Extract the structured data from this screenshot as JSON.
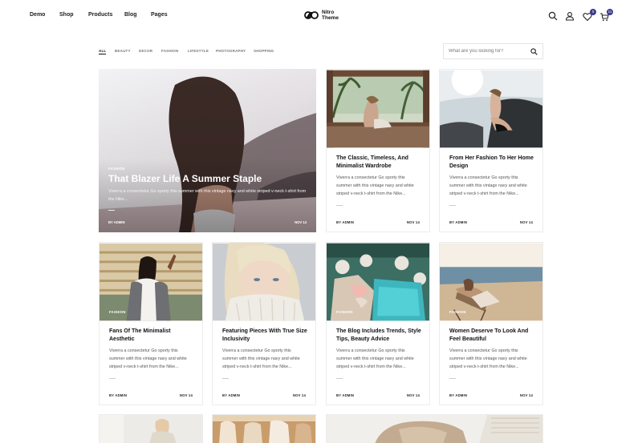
{
  "nav": {
    "items": [
      "Demo",
      "Shop",
      "Products",
      "Blog",
      "Pages"
    ]
  },
  "logo": {
    "line1": "Nitro",
    "line2": "Theme"
  },
  "header_icons": {
    "wishlist_count": "0",
    "cart_count": "11",
    "icons": [
      "search-icon",
      "account-icon",
      "heart-icon",
      "cart-icon"
    ]
  },
  "filters": {
    "items": [
      "ALL",
      "BEAUTY",
      "DECOR",
      "FASHION",
      "LIFESTYLE",
      "PHOTOGRAPHY",
      "SHOPPING"
    ],
    "active": "ALL"
  },
  "search": {
    "placeholder": "What are you looking for?"
  },
  "featured": {
    "category": "FASHION",
    "title": "That Blazer Life A Summer Staple",
    "excerpt": "Viverra a consectetur Go sporty this summer with this vintage navy and white striped v-neck t-shirt from the Nike...",
    "by": "BY ADMIN",
    "date": "NOV 14"
  },
  "posts": [
    {
      "title": "The Classic, Timeless, And Minimalist Wardrobe",
      "excerpt": "Viverra a consectetur Go sporty this summer with this vintage navy and white striped v-neck t-shirt from the Nike...",
      "by": "BY ADMIN",
      "date": "NOV 14",
      "category": ""
    },
    {
      "title": "From Her Fashion To Her Home Design",
      "excerpt": "Viverra a consectetur Go sporty this summer with this vintage navy and white striped v-neck t-shirt from the Nike...",
      "by": "BY ADMIN",
      "date": "NOV 14",
      "category": ""
    },
    {
      "title": "Fans Of The Minimalist Aesthetic",
      "excerpt": "Viverra a consectetur Go sporty this summer with this vintage navy and white striped v-neck t-shirt from the Nike...",
      "by": "BY ADMIN",
      "date": "NOV 14",
      "category": "FASHION"
    },
    {
      "title": "Featuring Pieces With True Size Inclusivity",
      "excerpt": "Viverra a consectetur Go sporty this summer with this vintage navy and white striped v-neck t-shirt from the Nike...",
      "by": "BY ADMIN",
      "date": "NOV 14",
      "category": ""
    },
    {
      "title": "The Blog Includes Trends, Style Tips, Beauty Advice",
      "excerpt": "Viverra a consectetur Go sporty this summer with this vintage navy and white striped v-neck t-shirt from the Nike...",
      "by": "BY ADMIN",
      "date": "NOV 14",
      "category": "FASHION"
    },
    {
      "title": "Women Deserve To Look And Feel Beautiful",
      "excerpt": "Viverra a consectetur Go sporty this summer with this vintage navy and white striped v-neck t-shirt from the Nike...",
      "by": "BY ADMIN",
      "date": "NOV 14",
      "category": "FASHION"
    }
  ],
  "colors": {
    "accent": "#3d3b8e",
    "text": "#222222",
    "muted": "#555555"
  }
}
